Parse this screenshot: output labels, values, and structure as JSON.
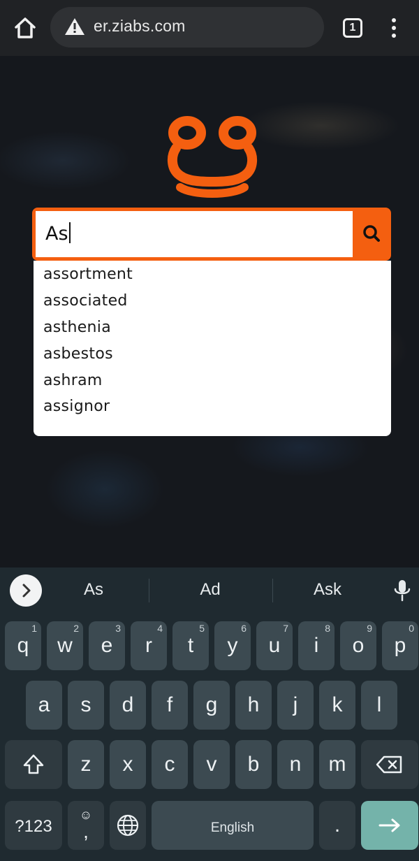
{
  "browser": {
    "url": "er.ziabs.com",
    "tab_count": "1"
  },
  "colors": {
    "accent": "#f45f10",
    "enter_key": "#74b3aa",
    "keyboard_bg": "#1f2a30",
    "key_bg": "#3c4a51"
  },
  "search": {
    "value": "As",
    "button_icon": "search-icon"
  },
  "suggestions": [
    "assortment",
    "associated",
    "asthenia",
    "asbestos",
    "ashram",
    "assignor"
  ],
  "keyboard": {
    "suggestions": [
      "As",
      "Ad",
      "Ask"
    ],
    "row1": [
      {
        "label": "q",
        "hint": "1"
      },
      {
        "label": "w",
        "hint": "2"
      },
      {
        "label": "e",
        "hint": "3"
      },
      {
        "label": "r",
        "hint": "4"
      },
      {
        "label": "t",
        "hint": "5"
      },
      {
        "label": "y",
        "hint": "6"
      },
      {
        "label": "u",
        "hint": "7"
      },
      {
        "label": "i",
        "hint": "8"
      },
      {
        "label": "o",
        "hint": "9"
      },
      {
        "label": "p",
        "hint": "0"
      }
    ],
    "row2": [
      "a",
      "s",
      "d",
      "f",
      "g",
      "h",
      "j",
      "k",
      "l"
    ],
    "row3": [
      "z",
      "x",
      "c",
      "v",
      "b",
      "n",
      "m"
    ],
    "symbols_label": "?123",
    "emoji_top": "☺",
    "emoji_bottom": ",",
    "space_label": "English",
    "period_label": "."
  }
}
